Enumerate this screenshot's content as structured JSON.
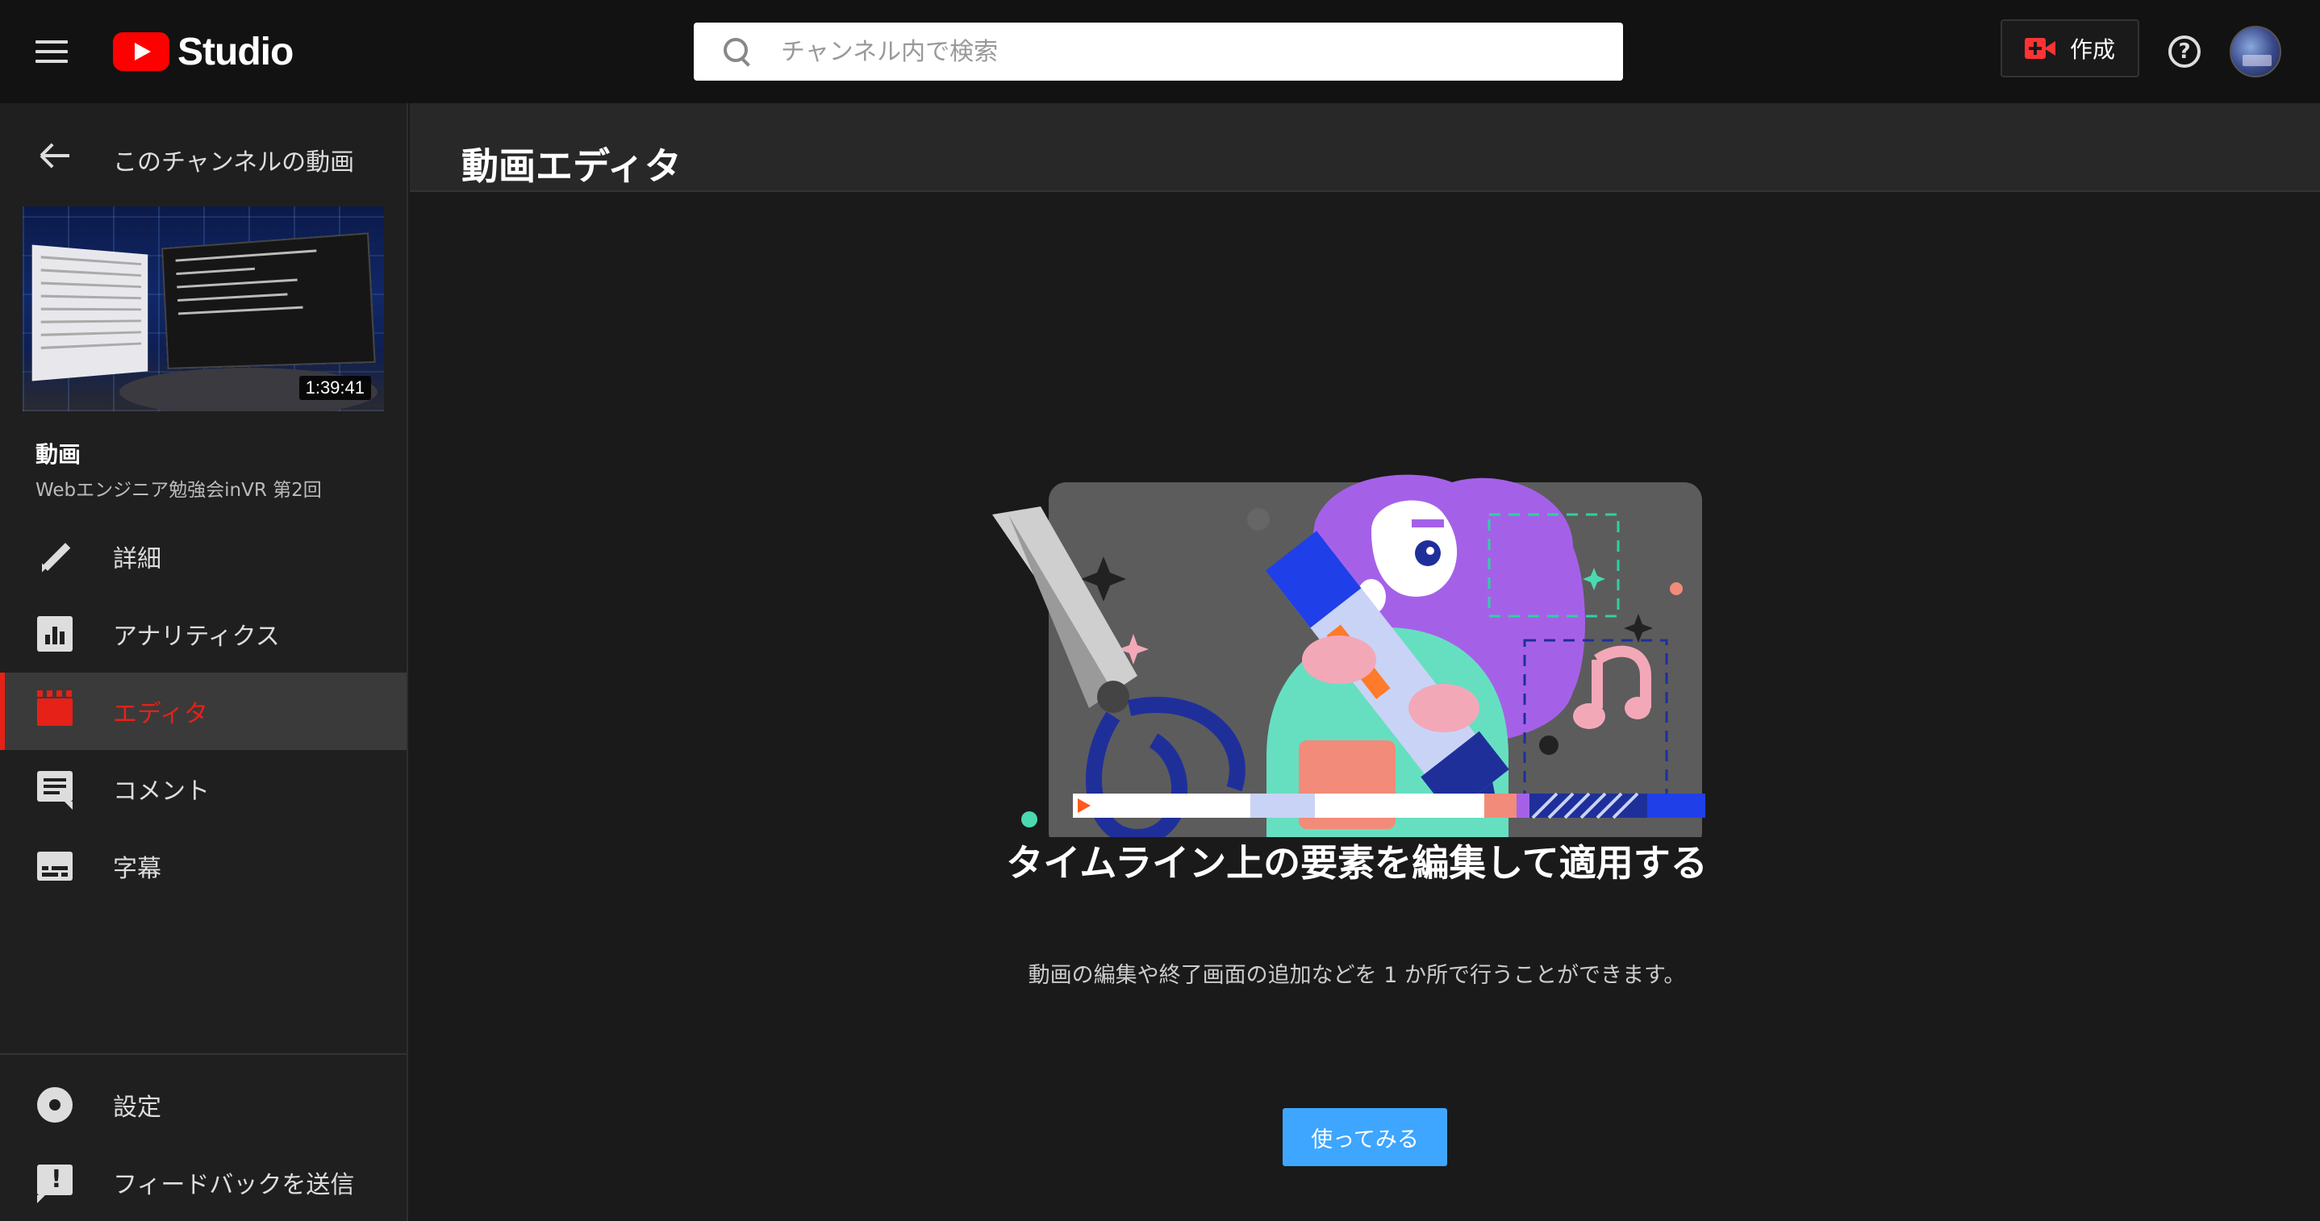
{
  "app": {
    "logo_text": "Studio",
    "brand_color": "#ff0000",
    "accent_color": "#e62117",
    "cta_color": "#3ea6ff"
  },
  "header": {
    "menu_icon": "hamburger-menu-icon",
    "search": {
      "placeholder": "チャンネル内で検索",
      "value": ""
    },
    "create_label": "作成",
    "help_icon": "help-circle-icon",
    "avatar_icon": "account-avatar"
  },
  "sidebar": {
    "back_label": "このチャンネルの動画",
    "video": {
      "duration": "1:39:41",
      "section_label": "動画",
      "title": "Webエンジニア勉強会inVR 第2回"
    },
    "items": [
      {
        "label": "詳細",
        "icon": "pencil-icon",
        "active": false
      },
      {
        "label": "アナリティクス",
        "icon": "analytics-icon",
        "active": false
      },
      {
        "label": "エディタ",
        "icon": "clapperboard-icon",
        "active": true
      },
      {
        "label": "コメント",
        "icon": "comment-icon",
        "active": false
      },
      {
        "label": "字幕",
        "icon": "subtitles-icon",
        "active": false
      }
    ],
    "bottom_items": [
      {
        "label": "設定",
        "icon": "gear-icon"
      },
      {
        "label": "フィードバックを送信",
        "icon": "feedback-icon"
      }
    ]
  },
  "main": {
    "page_title": "動画エディタ",
    "headline": "タイムライン上の要素を編集して適用する",
    "description": "動画の編集や終了画面の追加などを 1 か所で行うことができます。",
    "cta_label": "使ってみる"
  }
}
